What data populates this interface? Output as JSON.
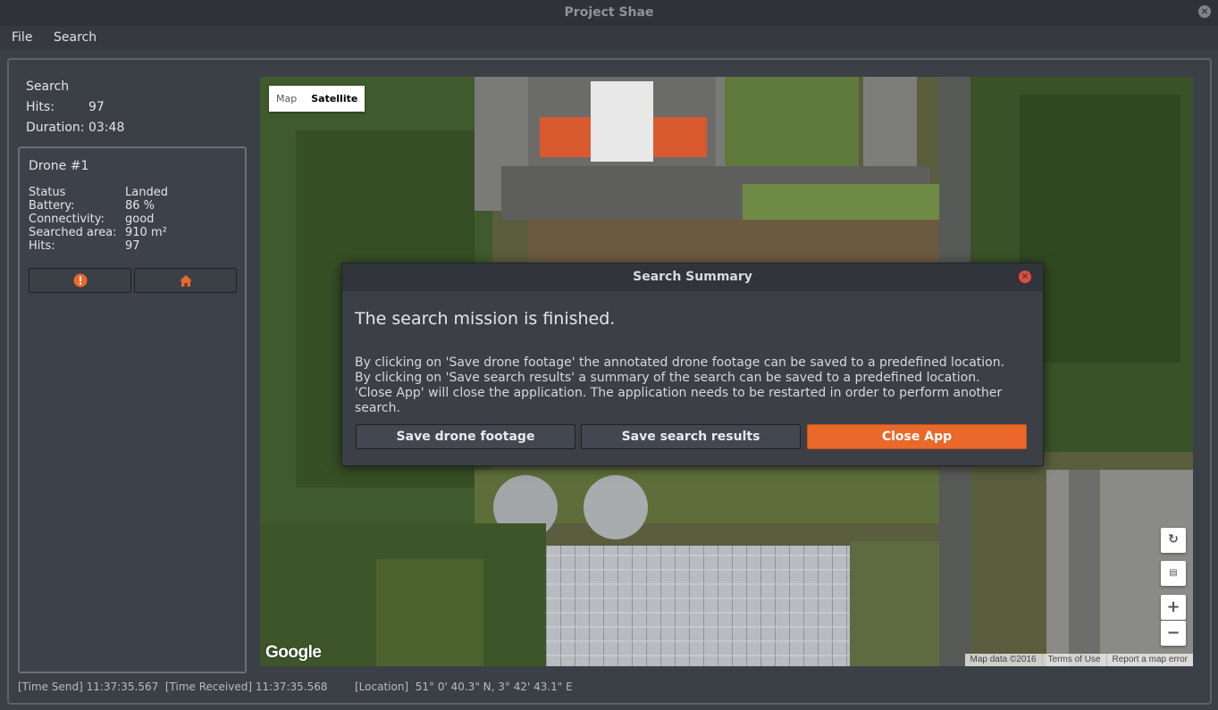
{
  "window": {
    "title": "Project Shae"
  },
  "menu": {
    "file": "File",
    "search": "Search"
  },
  "stats": {
    "heading": "Search",
    "hits_label": "Hits:",
    "hits_value": "97",
    "duration_label": "Duration:",
    "duration_value": "03:48"
  },
  "drone": {
    "title": "Drone #1",
    "rows": [
      {
        "label": "Status",
        "value": "Landed"
      },
      {
        "label": "Battery:",
        "value": "86 %"
      },
      {
        "label": "Connectivity:",
        "value": "good"
      },
      {
        "label": "Searched area:",
        "value": "910 m²"
      },
      {
        "label": "Hits:",
        "value": "97"
      }
    ],
    "buttons": [
      {
        "icon": "alert-icon",
        "color": "#e9682a"
      },
      {
        "icon": "home-icon",
        "color": "#e9682a"
      }
    ]
  },
  "map": {
    "type_map": "Map",
    "type_satellite": "Satellite",
    "selected": "Satellite",
    "logo": "Google",
    "attribution": "Map data ©2016",
    "terms": "Terms of Use",
    "report": "Report a map error",
    "controls": {
      "zoom_in": "+",
      "zoom_out": "−"
    }
  },
  "dialog": {
    "title": "Search Summary",
    "heading": "The search mission is finished.",
    "body_lines": [
      "By clicking on 'Save drone footage' the annotated drone footage can be saved to a predefined location.",
      "By clicking on 'Save search results' a summary of the search can be saved to a predefined location.",
      "'Close App' will close the application. The application needs to be restarted in order to perform another search."
    ],
    "buttons": {
      "save_footage": "Save drone footage",
      "save_results": "Save search results",
      "close_app": "Close App"
    },
    "accent": "#e9682a"
  },
  "status": {
    "time_send_label": "[Time Send]",
    "time_send": "11:37:35.567",
    "time_received_label": "[Time Received]",
    "time_received": "11:37:35.568",
    "location_label": "[Location]",
    "location": "51° 0' 40.3\" N, 3° 42' 43.1\" E"
  }
}
